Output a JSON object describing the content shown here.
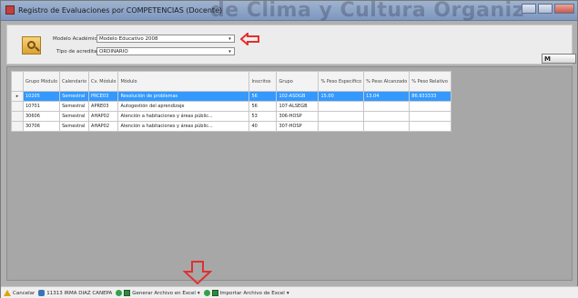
{
  "window": {
    "title": "Registro de Evaluaciones por COMPETENCIAS (Docente)",
    "background_text": "de Clima y Cultura Organiz"
  },
  "filters": {
    "modelo_label": "Modelo Académico",
    "modelo_value": "Modelo Educativo 2008",
    "acreditacion_label": "Tipo de acreditación",
    "acreditacion_value": "ORDINARIO"
  },
  "grid": {
    "headers": [
      "Grupo Módulo",
      "Calendario",
      "Cv. Módulo",
      "Módulo",
      "Inscritos",
      "Grupo",
      "% Peso Específico",
      "% Peso Alcanzado",
      "% Peso Relativo"
    ],
    "rows": [
      {
        "selected": true,
        "cells": [
          "10205",
          "Semestral",
          "PRCE03",
          "Resolución de problemas",
          "56",
          "102-ASDGB",
          "15.00",
          "13.04",
          "86.933333"
        ]
      },
      {
        "selected": false,
        "cells": [
          "10701",
          "Semestral",
          "APRE03",
          "Autogestión del aprendizaje",
          "56",
          "107-ALSEGB",
          "",
          "",
          ""
        ]
      },
      {
        "selected": false,
        "cells": [
          "30606",
          "Semestral",
          "AHAP02",
          "Atención a habitaciones y áreas públic...",
          "53",
          "306-HOSP",
          "",
          "",
          ""
        ]
      },
      {
        "selected": false,
        "cells": [
          "30706",
          "Semestral",
          "AHAP02",
          "Atención a habitaciones y áreas públic...",
          "40",
          "307-HOSP",
          "",
          "",
          ""
        ]
      }
    ],
    "selected_color": "#3399ff"
  },
  "statusbar": {
    "cancel_label": "Cancelar",
    "user_label": "11313 IRMA DIAZ CANEPA",
    "export_label": "Generar Archivo en Excel",
    "import_label": "Importar Archivo de Excel"
  },
  "colors": {
    "arrow_red": "#e03030",
    "titlebar": "#8aa3c7"
  }
}
